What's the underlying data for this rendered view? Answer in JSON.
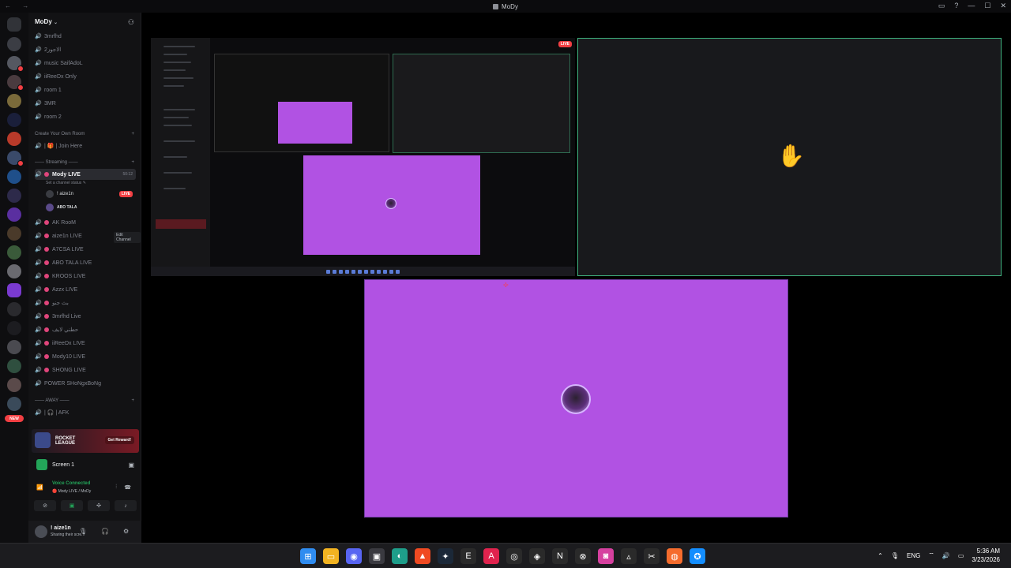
{
  "window": {
    "title": "MoDy",
    "nav_glyphs": "← →",
    "controls": [
      "▭",
      "?",
      "—",
      "☐",
      "✕"
    ]
  },
  "server": {
    "name": "MoDy",
    "channels_top": [
      "3mrfhd",
      "الاجوز2",
      "music SaifAdoL",
      "iiReeDx Only",
      "room 1",
      "3MR",
      "room 2"
    ],
    "category_room": "Create Your Own Room",
    "join_here": "| 🎁 | Join Here",
    "category_streaming": "—— Streaming ——",
    "active_channel": {
      "name": "Mody LIVE",
      "timer": "50:12",
      "status": "Set a channel status ✎"
    },
    "members": [
      {
        "name": "! aize1n",
        "live": "LIVE"
      },
      {
        "name": "ABO TALA",
        "live": ""
      }
    ],
    "channels_stream": [
      "AK RooM",
      "aize1n LIVE",
      "A7CSA LIVE",
      "ABO TALA LIVE",
      "KROOS LIVE",
      "Azzx LIVE",
      "بث جنو",
      "3mrfhd Live",
      "حطني لايف",
      "iiReeDx LIVE",
      "Mody10 LIVE",
      "SHONG LIVE",
      "POWER SHoNgxBoNg"
    ],
    "tooltip": "Edit Channel",
    "category_away": "—— AWAY ——",
    "afk": "| 🎧 | AFK"
  },
  "guild_new_badge": "NEW",
  "promo": {
    "brand": "ROCKET LEAGUE",
    "button": "Get Reward!"
  },
  "screen_panel": {
    "label": "Screen 1"
  },
  "voice": {
    "status": "Voice Connected",
    "where": "🔴 Mody LIVE / MoDy"
  },
  "user": {
    "name": "! aize1n",
    "status": "Sharing their scre..."
  },
  "stage": {
    "live_badge": "LIVE"
  },
  "taskbar": {
    "language": "ENG",
    "time": "5:36 AM",
    "date": "3/23/2026",
    "apps": [
      {
        "name": "windows-start",
        "glyph": "⊞",
        "color": "#2f8cf0"
      },
      {
        "name": "file-explorer",
        "glyph": "▭",
        "color": "#f2b321"
      },
      {
        "name": "discord",
        "glyph": "◉",
        "color": "#5865f2"
      },
      {
        "name": "store",
        "glyph": "▣",
        "color": "#3a3a40"
      },
      {
        "name": "edge",
        "glyph": "◐",
        "color": "#1e9e8a"
      },
      {
        "name": "brave",
        "glyph": "▲",
        "color": "#f04a22"
      },
      {
        "name": "steam",
        "glyph": "✦",
        "color": "#1b2838"
      },
      {
        "name": "epic-games",
        "glyph": "E",
        "color": "#2a2a2a"
      },
      {
        "name": "adobe-app",
        "glyph": "A",
        "color": "#e0234e"
      },
      {
        "name": "obs",
        "glyph": "◎",
        "color": "#2a2a2a"
      },
      {
        "name": "overwatch",
        "glyph": "◈",
        "color": "#2a2a2a"
      },
      {
        "name": "notion",
        "glyph": "N",
        "color": "#2a2a2a"
      },
      {
        "name": "xbox",
        "glyph": "⊗",
        "color": "#2a2a2a"
      },
      {
        "name": "instagram",
        "glyph": "◙",
        "color": "#d6409f"
      },
      {
        "name": "arc-app",
        "glyph": "▵",
        "color": "#2a2a2a"
      },
      {
        "name": "capcut",
        "glyph": "✂",
        "color": "#2a2a2a"
      },
      {
        "name": "origin",
        "glyph": "◍",
        "color": "#f56c2d"
      },
      {
        "name": "battle-net",
        "glyph": "✪",
        "color": "#148eff"
      }
    ]
  },
  "colors": {
    "accent_green": "#23a559",
    "live_red": "#f23f43",
    "stream_purple": "#b152e3",
    "cam_border": "#3fb27f"
  }
}
